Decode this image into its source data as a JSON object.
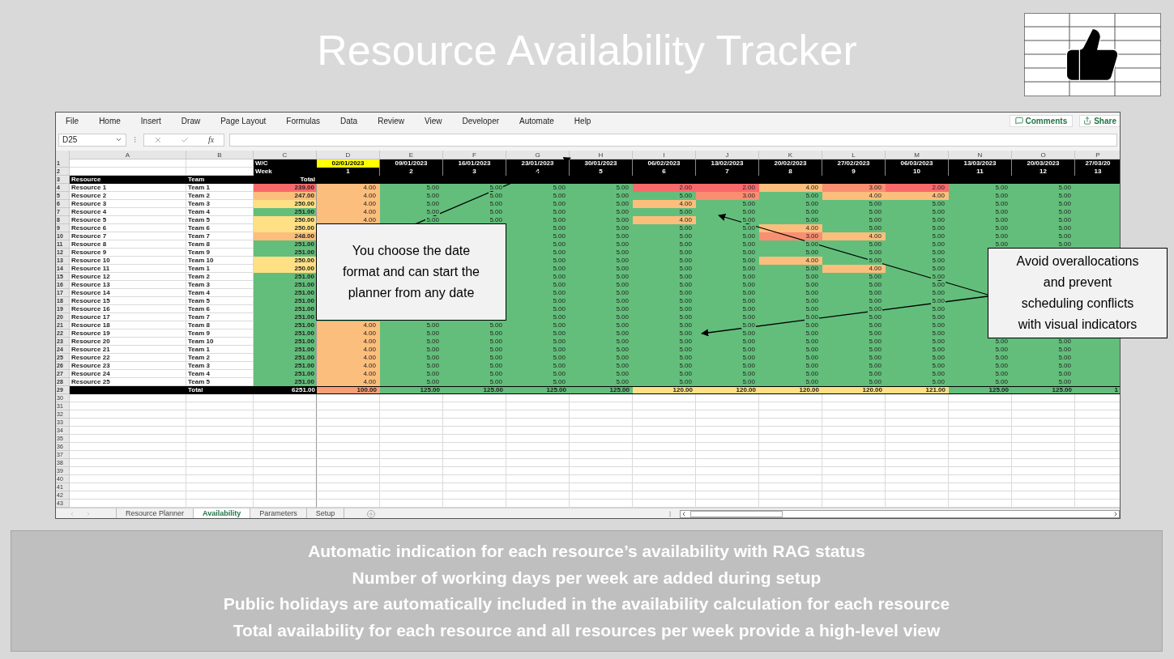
{
  "title": "Resource Availability Tracker",
  "excel": {
    "menu": [
      "File",
      "Home",
      "Insert",
      "Draw",
      "Page Layout",
      "Formulas",
      "Data",
      "Review",
      "View",
      "Developer",
      "Automate",
      "Help"
    ],
    "comments_button": "Comments",
    "share_button": "Share",
    "name_box": "D25",
    "formula_label": "fx",
    "column_letters": [
      "A",
      "B",
      "C",
      "D",
      "E",
      "F",
      "G",
      "H",
      "I",
      "J",
      "K",
      "L",
      "M",
      "N",
      "O",
      "P"
    ],
    "header_row_numbers": [
      "1",
      "2",
      "3"
    ],
    "row1_label": "W/C",
    "row2_label": "Week",
    "dates": [
      {
        "text": "02/01/2023",
        "highlighted": true
      },
      {
        "text": "09/01/2023",
        "highlighted": false
      },
      {
        "text": "16/01/2023",
        "highlighted": false
      },
      {
        "text": "23/01/2023",
        "highlighted": false
      },
      {
        "text": "30/01/2023",
        "highlighted": false
      },
      {
        "text": "06/02/2023",
        "highlighted": false
      },
      {
        "text": "13/02/2023",
        "highlighted": false
      },
      {
        "text": "20/02/2023",
        "highlighted": false
      },
      {
        "text": "27/02/2023",
        "highlighted": false
      },
      {
        "text": "06/03/2023",
        "highlighted": false
      },
      {
        "text": "13/03/2023",
        "highlighted": false
      },
      {
        "text": "20/03/2023",
        "highlighted": false
      },
      {
        "text": "27/03/20",
        "highlighted": false
      }
    ],
    "weeks": [
      "1",
      "2",
      "3",
      "4",
      "5",
      "6",
      "7",
      "8",
      "9",
      "10",
      "11",
      "12",
      "13"
    ],
    "resource_header": "Resource",
    "team_header": "Team",
    "total_header": "Total",
    "rows": [
      {
        "num": "4",
        "resource": "Resource 1",
        "team": "Team 1",
        "total": {
          "value": "239.00",
          "color": "#f8696b"
        },
        "cells": [
          {
            "value": "4.00",
            "color": "#fbbe7c"
          },
          {
            "value": "5.00",
            "color": "#63be7b"
          },
          {
            "value": "5.00",
            "color": "#63be7b"
          },
          {
            "value": "5.00",
            "color": "#63be7b"
          },
          {
            "value": "5.00",
            "color": "#63be7b"
          },
          {
            "value": "2.00",
            "color": "#f8696b"
          },
          {
            "value": "2.00",
            "color": "#f8696b"
          },
          {
            "value": "4.00",
            "color": "#fbbe7c"
          },
          {
            "value": "3.00",
            "color": "#f98e71"
          },
          {
            "value": "2.00",
            "color": "#f8696b"
          },
          {
            "value": "5.00",
            "color": "#63be7b"
          },
          {
            "value": "5.00",
            "color": "#63be7b"
          },
          {
            "color": "#63be7b"
          }
        ]
      },
      {
        "num": "5",
        "resource": "Resource 2",
        "team": "Team 2",
        "total": {
          "value": "247.00",
          "color": "#fbbe7c"
        },
        "cells": [
          {
            "value": "4.00",
            "color": "#fbbe7c"
          },
          {
            "value": "5.00",
            "color": "#63be7b"
          },
          {
            "value": "5.00",
            "color": "#63be7b"
          },
          {
            "value": "5.00",
            "color": "#63be7b"
          },
          {
            "value": "5.00",
            "color": "#63be7b"
          },
          {
            "value": "5.00",
            "color": "#63be7b"
          },
          {
            "value": "3.00",
            "color": "#f98e71"
          },
          {
            "value": "5.00",
            "color": "#63be7b"
          },
          {
            "value": "4.00",
            "color": "#fbbe7c"
          },
          {
            "value": "4.00",
            "color": "#fbbe7c"
          },
          {
            "value": "5.00",
            "color": "#63be7b"
          },
          {
            "value": "5.00",
            "color": "#63be7b"
          },
          {
            "color": "#63be7b"
          }
        ]
      },
      {
        "num": "6",
        "resource": "Resource 3",
        "team": "Team 3",
        "total": {
          "value": "250.00",
          "color": "#ffe084"
        },
        "cells": [
          {
            "value": "4.00",
            "color": "#fbbe7c"
          },
          {
            "value": "5.00",
            "color": "#63be7b"
          },
          {
            "value": "5.00",
            "color": "#63be7b"
          },
          {
            "value": "5.00",
            "color": "#63be7b"
          },
          {
            "value": "5.00",
            "color": "#63be7b"
          },
          {
            "value": "4.00",
            "color": "#fbbe7c"
          },
          {
            "value": "5.00",
            "color": "#63be7b"
          },
          {
            "value": "5.00",
            "color": "#63be7b"
          },
          {
            "value": "5.00",
            "color": "#63be7b"
          },
          {
            "value": "5.00",
            "color": "#63be7b"
          },
          {
            "value": "5.00",
            "color": "#63be7b"
          },
          {
            "value": "5.00",
            "color": "#63be7b"
          },
          {
            "color": "#63be7b"
          }
        ]
      },
      {
        "num": "7",
        "resource": "Resource 4",
        "team": "Team 4",
        "total": {
          "value": "251.00",
          "color": "#63be7b"
        },
        "cells": [
          {
            "value": "4.00",
            "color": "#fbbe7c"
          },
          {
            "value": "5.00",
            "color": "#63be7b"
          },
          {
            "value": "5.00",
            "color": "#63be7b"
          },
          {
            "value": "5.00",
            "color": "#63be7b"
          },
          {
            "value": "5.00",
            "color": "#63be7b"
          },
          {
            "value": "5.00",
            "color": "#63be7b"
          },
          {
            "value": "5.00",
            "color": "#63be7b"
          },
          {
            "value": "5.00",
            "color": "#63be7b"
          },
          {
            "value": "5.00",
            "color": "#63be7b"
          },
          {
            "value": "5.00",
            "color": "#63be7b"
          },
          {
            "value": "5.00",
            "color": "#63be7b"
          },
          {
            "value": "5.00",
            "color": "#63be7b"
          },
          {
            "color": "#63be7b"
          }
        ]
      },
      {
        "num": "8",
        "resource": "Resource 5",
        "team": "Team 5",
        "total": {
          "value": "250.00",
          "color": "#ffe084"
        },
        "cells": [
          {
            "value": "4.00",
            "color": "#fbbe7c"
          },
          {
            "value": "5.00",
            "color": "#63be7b"
          },
          {
            "value": "5.00",
            "color": "#63be7b"
          },
          {
            "value": "5.00",
            "color": "#63be7b"
          },
          {
            "value": "5.00",
            "color": "#63be7b"
          },
          {
            "value": "4.00",
            "color": "#fbbe7c"
          },
          {
            "value": "5.00",
            "color": "#63be7b"
          },
          {
            "value": "5.00",
            "color": "#63be7b"
          },
          {
            "value": "5.00",
            "color": "#63be7b"
          },
          {
            "value": "5.00",
            "color": "#63be7b"
          },
          {
            "value": "5.00",
            "color": "#63be7b"
          },
          {
            "value": "5.00",
            "color": "#63be7b"
          },
          {
            "color": "#63be7b"
          }
        ]
      },
      {
        "num": "9",
        "resource": "Resource 6",
        "team": "Team 6",
        "total": {
          "value": "250.00",
          "color": "#ffe084"
        },
        "cells": [
          null,
          null,
          null,
          {
            "value": "5.00",
            "color": "#63be7b"
          },
          {
            "value": "5.00",
            "color": "#63be7b"
          },
          {
            "value": "5.00",
            "color": "#63be7b"
          },
          {
            "value": "5.00",
            "color": "#63be7b"
          },
          {
            "value": "4.00",
            "color": "#fbbe7c"
          },
          {
            "value": "5.00",
            "color": "#63be7b"
          },
          {
            "value": "5.00",
            "color": "#63be7b"
          },
          {
            "value": "5.00",
            "color": "#63be7b"
          },
          {
            "value": "5.00",
            "color": "#63be7b"
          },
          {
            "color": "#63be7b"
          }
        ]
      },
      {
        "num": "10",
        "resource": "Resource 7",
        "team": "Team 7",
        "total": {
          "value": "248.00",
          "color": "#fbbe7c"
        },
        "cells": [
          null,
          null,
          null,
          {
            "value": "5.00",
            "color": "#63be7b"
          },
          {
            "value": "5.00",
            "color": "#63be7b"
          },
          {
            "value": "5.00",
            "color": "#63be7b"
          },
          {
            "value": "5.00",
            "color": "#63be7b"
          },
          {
            "value": "3.00",
            "color": "#f98e71"
          },
          {
            "value": "4.00",
            "color": "#fbbe7c"
          },
          {
            "value": "5.00",
            "color": "#63be7b"
          },
          {
            "value": "5.00",
            "color": "#63be7b"
          },
          {
            "value": "5.00",
            "color": "#63be7b"
          },
          {
            "color": "#63be7b"
          }
        ]
      },
      {
        "num": "11",
        "resource": "Resource 8",
        "team": "Team 8",
        "total": {
          "value": "251.00",
          "color": "#63be7b"
        },
        "cells": [
          null,
          null,
          null,
          {
            "value": "5.00",
            "color": "#63be7b"
          },
          {
            "value": "5.00",
            "color": "#63be7b"
          },
          {
            "value": "5.00",
            "color": "#63be7b"
          },
          {
            "value": "5.00",
            "color": "#63be7b"
          },
          {
            "value": "5.00",
            "color": "#63be7b"
          },
          {
            "value": "5.00",
            "color": "#63be7b"
          },
          {
            "value": "5.00",
            "color": "#63be7b"
          },
          {
            "value": "5.00",
            "color": "#63be7b"
          },
          {
            "value": "5.00",
            "color": "#63be7b"
          },
          {
            "color": "#63be7b"
          }
        ]
      },
      {
        "num": "12",
        "resource": "Resource 9",
        "team": "Team 9",
        "total": {
          "value": "251.00",
          "color": "#63be7b"
        },
        "cells": [
          null,
          null,
          null,
          {
            "value": "5.00",
            "color": "#63be7b"
          },
          {
            "value": "5.00",
            "color": "#63be7b"
          },
          {
            "value": "5.00",
            "color": "#63be7b"
          },
          {
            "value": "5.00",
            "color": "#63be7b"
          },
          {
            "value": "5.00",
            "color": "#63be7b"
          },
          {
            "value": "5.00",
            "color": "#63be7b"
          },
          {
            "value": "5.00",
            "color": "#63be7b"
          },
          null,
          null,
          null
        ]
      },
      {
        "num": "13",
        "resource": "Resource 10",
        "team": "Team 10",
        "total": {
          "value": "250.00",
          "color": "#ffe084"
        },
        "cells": [
          null,
          null,
          null,
          {
            "value": "5.00",
            "color": "#63be7b"
          },
          {
            "value": "5.00",
            "color": "#63be7b"
          },
          {
            "value": "5.00",
            "color": "#63be7b"
          },
          {
            "value": "5.00",
            "color": "#63be7b"
          },
          {
            "value": "4.00",
            "color": "#fbbe7c"
          },
          {
            "value": "5.00",
            "color": "#63be7b"
          },
          {
            "value": "5.00",
            "color": "#63be7b"
          },
          null,
          null,
          null
        ]
      },
      {
        "num": "14",
        "resource": "Resource 11",
        "team": "Team 1",
        "total": {
          "value": "250.00",
          "color": "#ffe084"
        },
        "cells": [
          null,
          null,
          null,
          {
            "value": "5.00",
            "color": "#63be7b"
          },
          {
            "value": "5.00",
            "color": "#63be7b"
          },
          {
            "value": "5.00",
            "color": "#63be7b"
          },
          {
            "value": "5.00",
            "color": "#63be7b"
          },
          {
            "value": "5.00",
            "color": "#63be7b"
          },
          {
            "value": "4.00",
            "color": "#fbbe7c"
          },
          {
            "value": "5.00",
            "color": "#63be7b"
          },
          null,
          null,
          null
        ]
      },
      {
        "num": "15",
        "resource": "Resource 12",
        "team": "Team 2",
        "total": {
          "value": "251.00",
          "color": "#63be7b"
        },
        "cells": [
          null,
          null,
          null,
          {
            "value": "5.00",
            "color": "#63be7b"
          },
          {
            "value": "5.00",
            "color": "#63be7b"
          },
          {
            "value": "5.00",
            "color": "#63be7b"
          },
          {
            "value": "5.00",
            "color": "#63be7b"
          },
          {
            "value": "5.00",
            "color": "#63be7b"
          },
          {
            "value": "5.00",
            "color": "#63be7b"
          },
          {
            "value": "5.00",
            "color": "#63be7b"
          },
          null,
          null,
          null
        ]
      },
      {
        "num": "16",
        "resource": "Resource 13",
        "team": "Team 3",
        "total": {
          "value": "251.00",
          "color": "#63be7b"
        },
        "cells": [
          null,
          null,
          null,
          {
            "value": "5.00",
            "color": "#63be7b"
          },
          {
            "value": "5.00",
            "color": "#63be7b"
          },
          {
            "value": "5.00",
            "color": "#63be7b"
          },
          {
            "value": "5.00",
            "color": "#63be7b"
          },
          {
            "value": "5.00",
            "color": "#63be7b"
          },
          {
            "value": "5.00",
            "color": "#63be7b"
          },
          {
            "value": "5.00",
            "color": "#63be7b"
          },
          null,
          null,
          null
        ]
      },
      {
        "num": "17",
        "resource": "Resource 14",
        "team": "Team 4",
        "total": {
          "value": "251.00",
          "color": "#63be7b"
        },
        "cells": [
          null,
          null,
          null,
          {
            "value": "5.00",
            "color": "#63be7b"
          },
          {
            "value": "5.00",
            "color": "#63be7b"
          },
          {
            "value": "5.00",
            "color": "#63be7b"
          },
          {
            "value": "5.00",
            "color": "#63be7b"
          },
          {
            "value": "5.00",
            "color": "#63be7b"
          },
          {
            "value": "5.00",
            "color": "#63be7b"
          },
          {
            "value": "5.00",
            "color": "#63be7b"
          },
          null,
          null,
          null
        ]
      },
      {
        "num": "18",
        "resource": "Resource 15",
        "team": "Team 5",
        "total": {
          "value": "251.00",
          "color": "#63be7b"
        },
        "cells": [
          null,
          null,
          null,
          {
            "value": "5.00",
            "color": "#63be7b"
          },
          {
            "value": "5.00",
            "color": "#63be7b"
          },
          {
            "value": "5.00",
            "color": "#63be7b"
          },
          {
            "value": "5.00",
            "color": "#63be7b"
          },
          {
            "value": "5.00",
            "color": "#63be7b"
          },
          {
            "value": "5.00",
            "color": "#63be7b"
          },
          {
            "value": "5.00",
            "color": "#63be7b"
          },
          null,
          null,
          null
        ]
      },
      {
        "num": "19",
        "resource": "Resource 16",
        "team": "Team 6",
        "total": {
          "value": "251.00",
          "color": "#63be7b"
        },
        "cells": [
          null,
          null,
          null,
          {
            "value": "5.00",
            "color": "#63be7b"
          },
          {
            "value": "5.00",
            "color": "#63be7b"
          },
          {
            "value": "5.00",
            "color": "#63be7b"
          },
          {
            "value": "5.00",
            "color": "#63be7b"
          },
          {
            "value": "5.00",
            "color": "#63be7b"
          },
          {
            "value": "5.00",
            "color": "#63be7b"
          },
          {
            "value": "5.00",
            "color": "#63be7b"
          },
          null,
          null,
          null
        ]
      },
      {
        "num": "20",
        "resource": "Resource 17",
        "team": "Team 7",
        "total": {
          "value": "251.00",
          "color": "#63be7b"
        },
        "cells": [
          null,
          null,
          null,
          {
            "value": "5.00",
            "color": "#63be7b"
          },
          {
            "value": "5.00",
            "color": "#63be7b"
          },
          {
            "value": "5.00",
            "color": "#63be7b"
          },
          {
            "value": "5.00",
            "color": "#63be7b"
          },
          {
            "value": "5.00",
            "color": "#63be7b"
          },
          {
            "value": "5.00",
            "color": "#63be7b"
          },
          {
            "value": "5.00",
            "color": "#63be7b"
          },
          null,
          null,
          null
        ]
      },
      {
        "num": "21",
        "resource": "Resource 18",
        "team": "Team 8",
        "total": {
          "value": "251.00",
          "color": "#63be7b"
        },
        "cells": [
          {
            "value": "4.00",
            "color": "#fbbe7c"
          },
          {
            "value": "5.00",
            "color": "#63be7b"
          },
          {
            "value": "5.00",
            "color": "#63be7b"
          },
          {
            "value": "5.00",
            "color": "#63be7b"
          },
          {
            "value": "5.00",
            "color": "#63be7b"
          },
          {
            "value": "5.00",
            "color": "#63be7b"
          },
          {
            "value": "5.00",
            "color": "#63be7b"
          },
          {
            "value": "5.00",
            "color": "#63be7b"
          },
          {
            "value": "5.00",
            "color": "#63be7b"
          },
          {
            "value": "5.00",
            "color": "#63be7b"
          },
          null,
          null,
          null
        ]
      },
      {
        "num": "22",
        "resource": "Resource 19",
        "team": "Team 9",
        "total": {
          "value": "251.00",
          "color": "#63be7b"
        },
        "cells": [
          {
            "value": "4.00",
            "color": "#fbbe7c"
          },
          {
            "value": "5.00",
            "color": "#63be7b"
          },
          {
            "value": "5.00",
            "color": "#63be7b"
          },
          {
            "value": "5.00",
            "color": "#63be7b"
          },
          {
            "value": "5.00",
            "color": "#63be7b"
          },
          {
            "value": "5.00",
            "color": "#63be7b"
          },
          {
            "value": "5.00",
            "color": "#63be7b"
          },
          {
            "value": "5.00",
            "color": "#63be7b"
          },
          {
            "value": "5.00",
            "color": "#63be7b"
          },
          {
            "value": "5.00",
            "color": "#63be7b"
          },
          null,
          null,
          null
        ]
      },
      {
        "num": "23",
        "resource": "Resource 20",
        "team": "Team 10",
        "total": {
          "value": "251.00",
          "color": "#63be7b"
        },
        "cells": [
          {
            "value": "4.00",
            "color": "#fbbe7c"
          },
          {
            "value": "5.00",
            "color": "#63be7b"
          },
          {
            "value": "5.00",
            "color": "#63be7b"
          },
          {
            "value": "5.00",
            "color": "#63be7b"
          },
          {
            "value": "5.00",
            "color": "#63be7b"
          },
          {
            "value": "5.00",
            "color": "#63be7b"
          },
          {
            "value": "5.00",
            "color": "#63be7b"
          },
          {
            "value": "5.00",
            "color": "#63be7b"
          },
          {
            "value": "5.00",
            "color": "#63be7b"
          },
          {
            "value": "5.00",
            "color": "#63be7b"
          },
          {
            "value": "5.00",
            "color": "#63be7b"
          },
          {
            "value": "5.00",
            "color": "#63be7b"
          },
          {
            "color": "#63be7b"
          }
        ]
      },
      {
        "num": "24",
        "resource": "Resource 21",
        "team": "Team 1",
        "total": {
          "value": "251.00",
          "color": "#63be7b"
        },
        "cells": [
          {
            "value": "4.00",
            "color": "#fbbe7c"
          },
          {
            "value": "5.00",
            "color": "#63be7b"
          },
          {
            "value": "5.00",
            "color": "#63be7b"
          },
          {
            "value": "5.00",
            "color": "#63be7b"
          },
          {
            "value": "5.00",
            "color": "#63be7b"
          },
          {
            "value": "5.00",
            "color": "#63be7b"
          },
          {
            "value": "5.00",
            "color": "#63be7b"
          },
          {
            "value": "5.00",
            "color": "#63be7b"
          },
          {
            "value": "5.00",
            "color": "#63be7b"
          },
          {
            "value": "5.00",
            "color": "#63be7b"
          },
          {
            "value": "5.00",
            "color": "#63be7b"
          },
          {
            "value": "5.00",
            "color": "#63be7b"
          },
          {
            "color": "#63be7b"
          }
        ]
      },
      {
        "num": "25",
        "resource": "Resource 22",
        "team": "Team 2",
        "total": {
          "value": "251.00",
          "color": "#63be7b"
        },
        "cells": [
          {
            "value": "4.00",
            "color": "#fbbe7c"
          },
          {
            "value": "5.00",
            "color": "#63be7b"
          },
          {
            "value": "5.00",
            "color": "#63be7b"
          },
          {
            "value": "5.00",
            "color": "#63be7b"
          },
          {
            "value": "5.00",
            "color": "#63be7b"
          },
          {
            "value": "5.00",
            "color": "#63be7b"
          },
          {
            "value": "5.00",
            "color": "#63be7b"
          },
          {
            "value": "5.00",
            "color": "#63be7b"
          },
          {
            "value": "5.00",
            "color": "#63be7b"
          },
          {
            "value": "5.00",
            "color": "#63be7b"
          },
          {
            "value": "5.00",
            "color": "#63be7b"
          },
          {
            "value": "5.00",
            "color": "#63be7b"
          },
          {
            "color": "#63be7b"
          }
        ]
      },
      {
        "num": "26",
        "resource": "Resource 23",
        "team": "Team 3",
        "total": {
          "value": "251.00",
          "color": "#63be7b"
        },
        "cells": [
          {
            "value": "4.00",
            "color": "#fbbe7c"
          },
          {
            "value": "5.00",
            "color": "#63be7b"
          },
          {
            "value": "5.00",
            "color": "#63be7b"
          },
          {
            "value": "5.00",
            "color": "#63be7b"
          },
          {
            "value": "5.00",
            "color": "#63be7b"
          },
          {
            "value": "5.00",
            "color": "#63be7b"
          },
          {
            "value": "5.00",
            "color": "#63be7b"
          },
          {
            "value": "5.00",
            "color": "#63be7b"
          },
          {
            "value": "5.00",
            "color": "#63be7b"
          },
          {
            "value": "5.00",
            "color": "#63be7b"
          },
          {
            "value": "5.00",
            "color": "#63be7b"
          },
          {
            "value": "5.00",
            "color": "#63be7b"
          },
          {
            "color": "#63be7b"
          }
        ]
      },
      {
        "num": "27",
        "resource": "Resource 24",
        "team": "Team 4",
        "total": {
          "value": "251.00",
          "color": "#63be7b"
        },
        "cells": [
          {
            "value": "4.00",
            "color": "#fbbe7c"
          },
          {
            "value": "5.00",
            "color": "#63be7b"
          },
          {
            "value": "5.00",
            "color": "#63be7b"
          },
          {
            "value": "5.00",
            "color": "#63be7b"
          },
          {
            "value": "5.00",
            "color": "#63be7b"
          },
          {
            "value": "5.00",
            "color": "#63be7b"
          },
          {
            "value": "5.00",
            "color": "#63be7b"
          },
          {
            "value": "5.00",
            "color": "#63be7b"
          },
          {
            "value": "5.00",
            "color": "#63be7b"
          },
          {
            "value": "5.00",
            "color": "#63be7b"
          },
          {
            "value": "5.00",
            "color": "#63be7b"
          },
          {
            "value": "5.00",
            "color": "#63be7b"
          },
          {
            "color": "#63be7b"
          }
        ]
      },
      {
        "num": "28",
        "resource": "Resource 25",
        "team": "Team 5",
        "total": {
          "value": "251.00",
          "color": "#63be7b"
        },
        "cells": [
          {
            "value": "4.00",
            "color": "#fbbe7c"
          },
          {
            "value": "5.00",
            "color": "#63be7b"
          },
          {
            "value": "5.00",
            "color": "#63be7b"
          },
          {
            "value": "5.00",
            "color": "#63be7b"
          },
          {
            "value": "5.00",
            "color": "#63be7b"
          },
          {
            "value": "5.00",
            "color": "#63be7b"
          },
          {
            "value": "5.00",
            "color": "#63be7b"
          },
          {
            "value": "5.00",
            "color": "#63be7b"
          },
          {
            "value": "5.00",
            "color": "#63be7b"
          },
          {
            "value": "5.00",
            "color": "#63be7b"
          },
          {
            "value": "5.00",
            "color": "#63be7b"
          },
          {
            "value": "5.00",
            "color": "#63be7b"
          },
          {
            "color": "#63be7b"
          }
        ]
      }
    ],
    "total_row": {
      "num": "29",
      "label": "Total",
      "total": "6251.00",
      "cells": [
        {
          "value": "100.00",
          "color": "#fa9d75"
        },
        {
          "value": "125.00",
          "color": "#63be7b"
        },
        {
          "value": "125.00",
          "color": "#63be7b"
        },
        {
          "value": "125.00",
          "color": "#63be7b"
        },
        {
          "value": "125.00",
          "color": "#63be7b"
        },
        {
          "value": "120.00",
          "color": "#ffe084"
        },
        {
          "value": "120.00",
          "color": "#ffe084"
        },
        {
          "value": "120.00",
          "color": "#ffe084"
        },
        {
          "value": "120.00",
          "color": "#ffe084"
        },
        {
          "value": "121.00",
          "color": "#ffe084"
        },
        {
          "value": "125.00",
          "color": "#63be7b"
        },
        {
          "value": "125.00",
          "color": "#63be7b"
        },
        {
          "value": "1",
          "color": "#63be7b"
        }
      ]
    },
    "empty_rows": [
      "30",
      "31",
      "32",
      "33",
      "34",
      "35",
      "36",
      "37",
      "38",
      "39",
      "40",
      "41",
      "42",
      "43"
    ],
    "sheet_tabs": [
      {
        "label": "Resource Planner",
        "selected": false
      },
      {
        "label": "Availability",
        "selected": true
      },
      {
        "label": "Parameters",
        "selected": false
      },
      {
        "label": "Setup",
        "selected": false
      }
    ]
  },
  "callouts": [
    "You choose the date format and can start the planner from any date",
    "Avoid overallocations and prevent scheduling conflicts with visual indicators"
  ],
  "features": [
    "Automatic indication for each resource’s availability with RAG status",
    "Number of working days per week are added during setup",
    "Public holidays are automatically included in the availability calculation for each resource",
    "Total availability for each resource and all resources per week provide a high-level view"
  ]
}
